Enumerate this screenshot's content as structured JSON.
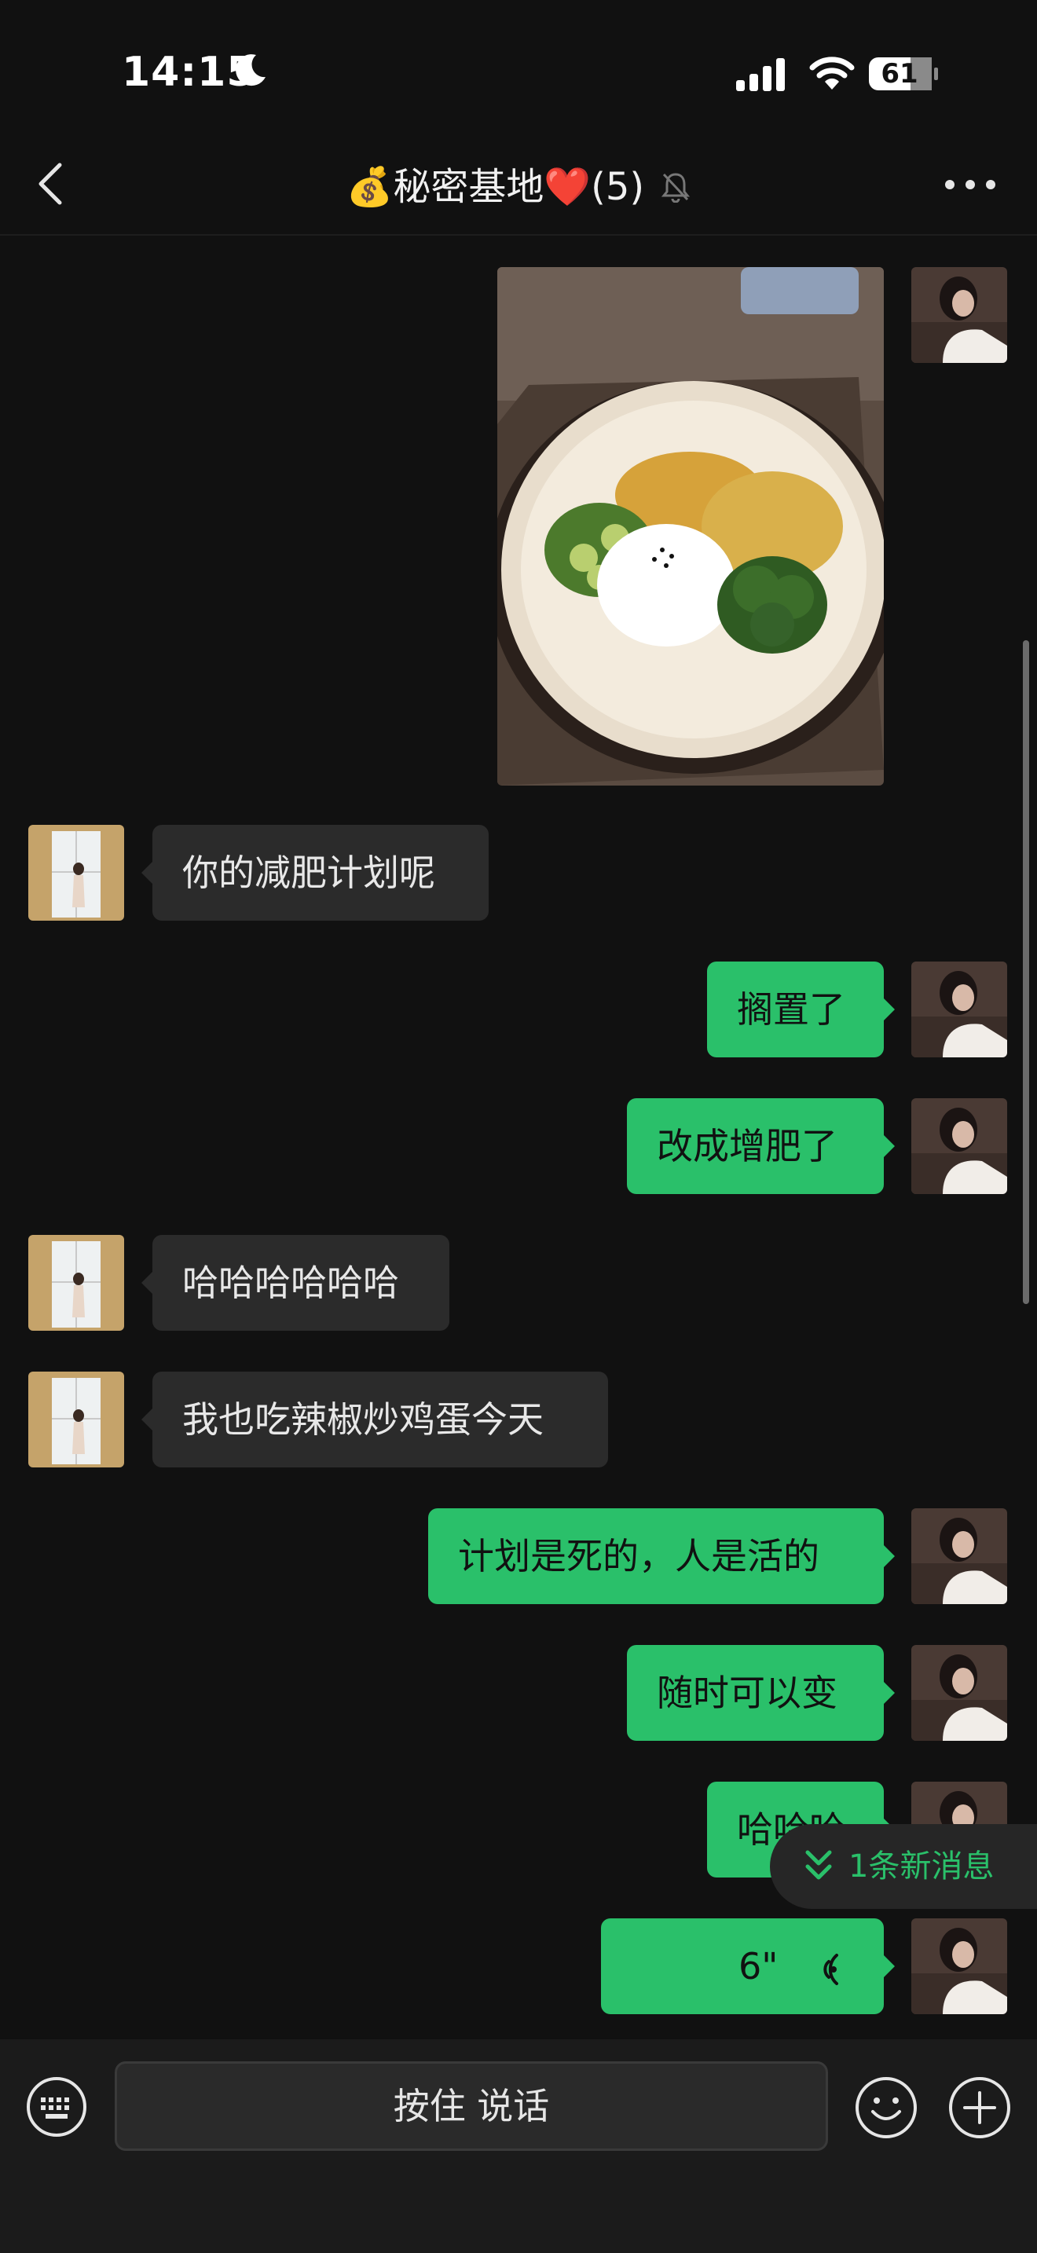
{
  "status_bar": {
    "time": "14:15",
    "battery": "61"
  },
  "header": {
    "money_emoji": "💰",
    "title": "秘密基地",
    "heart": "❤️",
    "count": "(5)",
    "mute_icon": "bell-slash-icon"
  },
  "messages": [
    {
      "from": "me",
      "type": "image",
      "alt": ""
    },
    {
      "from": "them",
      "text": "你的减肥计划呢"
    },
    {
      "from": "me",
      "text": "搁置了"
    },
    {
      "from": "me",
      "text": "改成增肥了"
    },
    {
      "from": "them",
      "text": "哈哈哈哈哈哈"
    },
    {
      "from": "them",
      "text": "我也吃辣椒炒鸡蛋今天"
    },
    {
      "from": "me",
      "text": "计划是死的，人是活的"
    },
    {
      "from": "me",
      "text": "随时可以变"
    },
    {
      "from": "me",
      "text": "哈哈哈"
    },
    {
      "from": "me",
      "type": "voice",
      "duration": "6\""
    }
  ],
  "new_message_pill": "1条新消息",
  "input_bar": {
    "hold_to_talk": "按住 说话"
  },
  "colors": {
    "background": "#111111",
    "my_bubble": "#2ac06a",
    "their_bubble": "#2b2b2b",
    "accent": "#2ac06a"
  }
}
